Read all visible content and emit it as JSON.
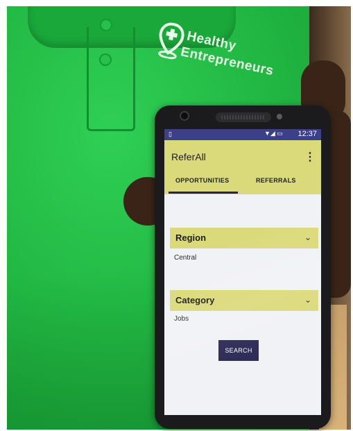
{
  "logo": {
    "line1": "Healthy",
    "line2": "Entrepreneurs",
    "icon": "location-pin-plus-icon"
  },
  "status_bar": {
    "left_icon": "sim-card-icon",
    "icons": "signal-battery-icons",
    "time": "12:37"
  },
  "app": {
    "title": "ReferAll",
    "overflow_icon": "more-vert-icon",
    "tabs": [
      {
        "label": "OPPORTUNITIES",
        "selected": true
      },
      {
        "label": "REFERRALS",
        "selected": false
      }
    ]
  },
  "filters": {
    "region": {
      "label": "Region",
      "value": "Central"
    },
    "category": {
      "label": "Category",
      "value": "Jobs"
    }
  },
  "actions": {
    "search_label": "SEARCH"
  },
  "colors": {
    "accent": "#dbda7b",
    "status_bar": "#3e3f8a",
    "button": "#2f2d58",
    "shirt": "#22b843"
  }
}
